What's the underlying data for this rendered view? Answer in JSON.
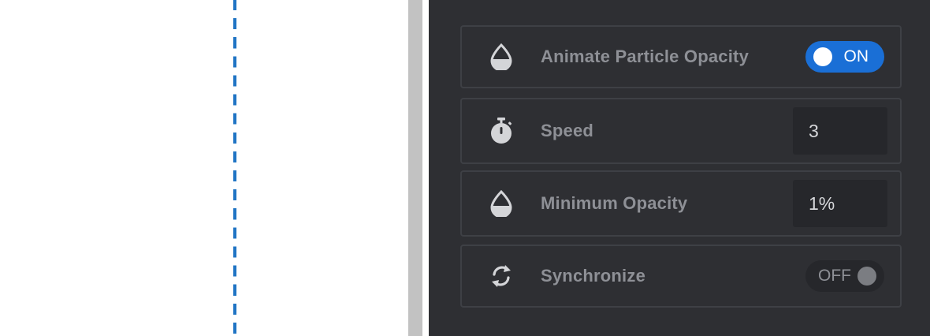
{
  "colors": {
    "panel_bg": "#2e2f33",
    "row_border": "#3e4045",
    "label_text": "#8e9096",
    "accent_blue": "#1a6fd6",
    "guide_line_blue": "#1f74c4",
    "splitter_gray": "#c2c2c2"
  },
  "settings": {
    "animate_opacity": {
      "icon": "opacity-drop-icon",
      "label": "Animate Particle Opacity",
      "toggle_text": "ON",
      "state": true
    },
    "speed": {
      "icon": "stopwatch-icon",
      "label": "Speed",
      "value": "3"
    },
    "minimum_opacity": {
      "icon": "opacity-drop-icon",
      "label": "Minimum Opacity",
      "value": "1%"
    },
    "synchronize": {
      "icon": "sync-icon",
      "label": "Synchronize",
      "toggle_text": "OFF",
      "state": false
    }
  }
}
